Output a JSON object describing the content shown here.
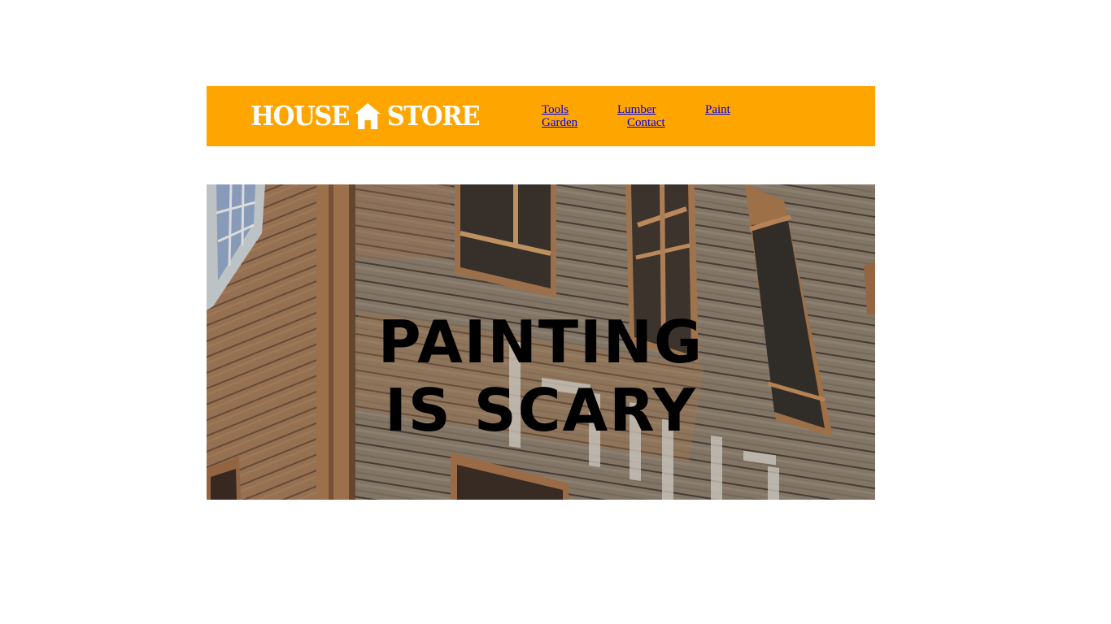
{
  "header": {
    "background_color": "#ffa500",
    "logo": {
      "left_text": "HOUSE",
      "icon": "house-icon",
      "right_text": "STORE"
    },
    "nav": [
      {
        "label": "Tools"
      },
      {
        "label": "Lumber"
      },
      {
        "label": "Paint"
      },
      {
        "label": "Garden"
      },
      {
        "label": "Contact"
      }
    ]
  },
  "hero": {
    "title_line1": "PAINTING",
    "title_line2": "IS SCARY",
    "subtitle": "",
    "background": "weathered-wooden-house-photo"
  }
}
